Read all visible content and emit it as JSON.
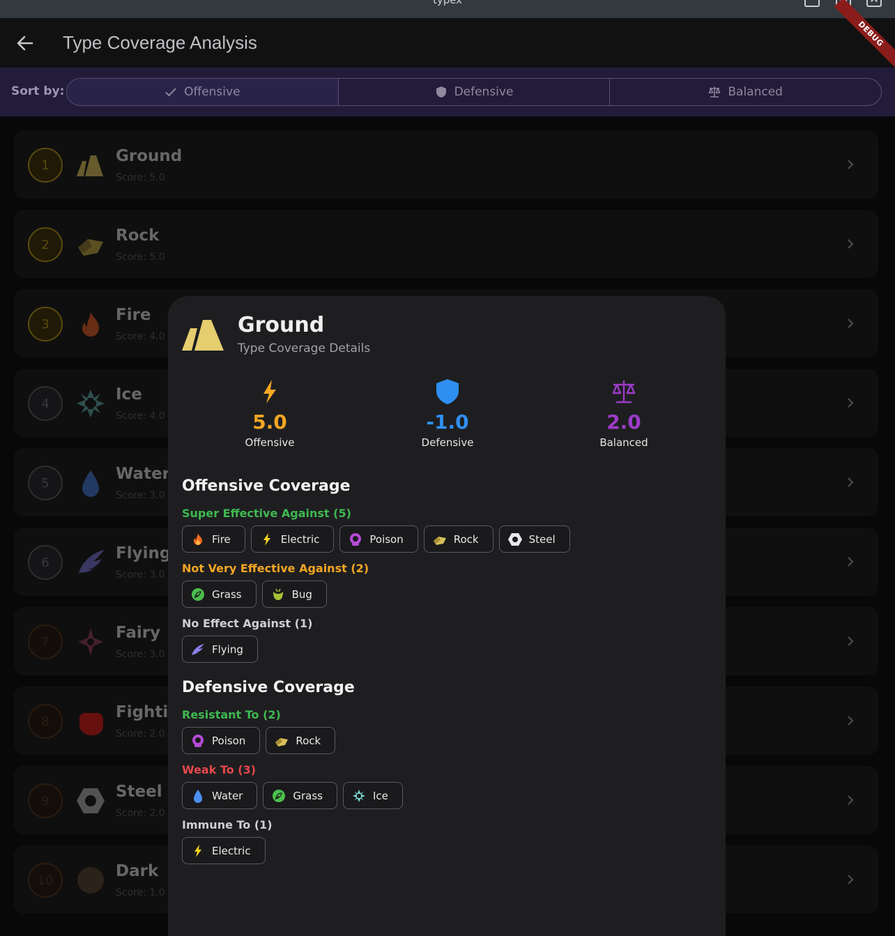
{
  "window": {
    "title": "typex"
  },
  "appbar": {
    "title": "Type Coverage Analysis",
    "debug_banner": "DEBUG"
  },
  "sort": {
    "label": "Sort by:",
    "options": [
      {
        "label": "Offensive",
        "icon": "check-icon",
        "selected": true
      },
      {
        "label": "Defensive",
        "icon": "shield-icon",
        "selected": false
      },
      {
        "label": "Balanced",
        "icon": "balance-scale-icon",
        "selected": false
      }
    ]
  },
  "list": [
    {
      "rank": "1",
      "name": "Ground",
      "score": "Score: 5.0",
      "icon": "ground-icon"
    },
    {
      "rank": "2",
      "name": "Rock",
      "score": "Score: 5.0",
      "icon": "rock-icon"
    },
    {
      "rank": "3",
      "name": "Fire",
      "score": "Score: 4.0",
      "icon": "fire-icon"
    },
    {
      "rank": "4",
      "name": "Ice",
      "score": "Score: 4.0",
      "icon": "ice-icon"
    },
    {
      "rank": "5",
      "name": "Water",
      "score": "Score: 3.0",
      "icon": "water-icon"
    },
    {
      "rank": "6",
      "name": "Flying",
      "score": "Score: 3.0",
      "icon": "flying-icon"
    },
    {
      "rank": "7",
      "name": "Fairy",
      "score": "Score: 3.0",
      "icon": "fairy-icon"
    },
    {
      "rank": "8",
      "name": "Fightin",
      "score": "Score: 2.0",
      "icon": "fighting-icon"
    },
    {
      "rank": "9",
      "name": "Steel",
      "score": "Score: 2.0",
      "icon": "steel-icon"
    },
    {
      "rank": "10",
      "name": "Dark",
      "score": "Score: 1.0",
      "icon": "dark-icon"
    }
  ],
  "dialog": {
    "title": "Ground",
    "subtitle": "Type Coverage Details",
    "stats": {
      "offensive": {
        "value": "5.0",
        "label": "Offensive",
        "color": "#f5a623"
      },
      "defensive": {
        "value": "-1.0",
        "label": "Defensive",
        "color": "#2f8ff0"
      },
      "balanced": {
        "value": "2.0",
        "label": "Balanced",
        "color": "#9c3cc8"
      }
    },
    "offensive_title": "Offensive Coverage",
    "super_effective": {
      "title": "Super Effective Against (5)",
      "color": "#3fb950",
      "types": [
        "Fire",
        "Electric",
        "Poison",
        "Rock",
        "Steel"
      ]
    },
    "not_very_effective": {
      "title": "Not Very Effective Against (2)",
      "color": "#f5a623",
      "types": [
        "Grass",
        "Bug"
      ]
    },
    "no_effect": {
      "title": "No Effect Against (1)",
      "color": "#cfcfd2",
      "types": [
        "Flying"
      ]
    },
    "defensive_title": "Defensive Coverage",
    "resistant": {
      "title": "Resistant To (2)",
      "color": "#3fb950",
      "types": [
        "Poison",
        "Rock"
      ]
    },
    "weak": {
      "title": "Weak To (3)",
      "color": "#e5484d",
      "types": [
        "Water",
        "Grass",
        "Ice"
      ]
    },
    "immune": {
      "title": "Immune To (1)",
      "color": "#cfcfd2",
      "types": [
        "Electric"
      ]
    }
  }
}
